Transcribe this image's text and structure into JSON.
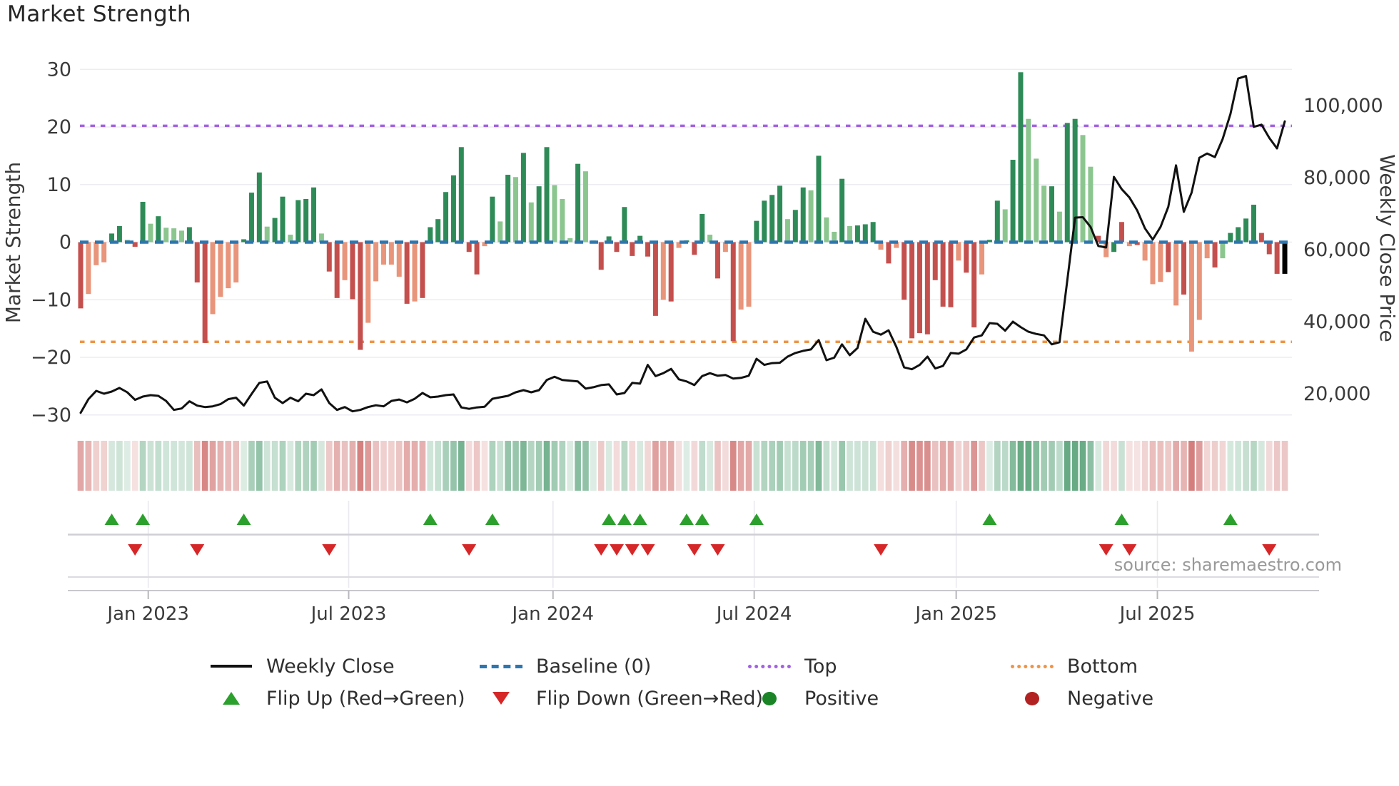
{
  "title": "Market Strength",
  "source": "source: sharemaestro.com",
  "axes": {
    "y_left_label": "Market Strength",
    "y_right_label": "Weekly Close Price",
    "y_left_ticks": [
      30,
      20,
      10,
      0,
      -10,
      -20,
      -30
    ],
    "y_right_ticks": [
      100000,
      80000,
      60000,
      40000,
      20000
    ],
    "x_ticks": [
      {
        "label": "Jan 2023",
        "week": 8.7
      },
      {
        "label": "Jul 2023",
        "week": 34.5
      },
      {
        "label": "Jan 2024",
        "week": 60.8
      },
      {
        "label": "Jul 2024",
        "week": 86.7
      },
      {
        "label": "Jan 2025",
        "week": 112.7
      },
      {
        "label": "Jul 2025",
        "week": 138.6
      }
    ]
  },
  "colors": {
    "dark_green": "#2e8b57",
    "light_green": "#8cc68f",
    "dark_red": "#c4504e",
    "light_red": "#e8957b",
    "price_line": "#111111",
    "baseline": "#2e76b0",
    "top_line": "#a261e3",
    "bottom_line": "#ef9446",
    "flip_up": "#2ca02c",
    "flip_down": "#d62728",
    "positive_dot": "#1a8426",
    "negative_dot": "#b22222",
    "grid": "#ececf2",
    "axis_text": "#3a3a3a",
    "source_text": "#999999"
  },
  "chart_data": {
    "type": "bar+line",
    "weeks": 156,
    "title": "Market Strength",
    "ylabel_left": "Market Strength",
    "ylabel_right": "Weekly Close Price",
    "y_left_range": [
      -32,
      32
    ],
    "baseline_value": 0,
    "top_line_value": 20.2,
    "bottom_line_value": -17.3,
    "legend_position": "bottom",
    "grid": true,
    "heatmap_from_bars": true,
    "bar_values": [
      -11.5,
      -9,
      -4,
      -3.5,
      1.5,
      2.8,
      0.4,
      -0.8,
      7,
      3.2,
      4.5,
      2.5,
      2.4,
      2,
      2.6,
      -7,
      -17.5,
      -12.5,
      -9.5,
      -8,
      -7,
      0.5,
      8.6,
      12.1,
      2.7,
      4.2,
      7.9,
      1.3,
      7.3,
      7.5,
      9.5,
      1.5,
      -5.1,
      -9.7,
      -6.6,
      -9.9,
      -18.7,
      -14,
      -6.8,
      -3.9,
      -3.9,
      -6,
      -10.7,
      -10.3,
      -9.7,
      2.6,
      4,
      8.7,
      11.6,
      16.5,
      -1.7,
      -5.6,
      -0.7,
      7.9,
      3.6,
      11.7,
      11.3,
      15.5,
      6.9,
      9.7,
      16.5,
      9.9,
      7.5,
      0.7,
      13.6,
      12.3,
      0.3,
      -4.8,
      1,
      -1.7,
      6.1,
      -2.4,
      1.1,
      -2.5,
      -12.8,
      -10,
      -10.3,
      -1,
      0.3,
      -2.2,
      4.9,
      1.3,
      -6.3,
      -1.7,
      -17.2,
      -11.7,
      -11.2,
      3.7,
      7.2,
      8.2,
      9.8,
      4,
      5.6,
      9.5,
      9,
      15,
      4.3,
      1.8,
      11,
      2.8,
      2.9,
      3.1,
      3.5,
      -1.3,
      -3.7,
      -1,
      -10,
      -16.7,
      -15.8,
      -16,
      -6.6,
      -11.2,
      -11.3,
      -3.2,
      -5.3,
      -14.8,
      -5.6,
      0.4,
      7.2,
      5.7,
      14.3,
      29.5,
      21.4,
      14.5,
      9.8,
      9.7,
      5.3,
      20.7,
      21.4,
      18.6,
      13.1,
      1.1,
      -2.6,
      -1.7,
      3.5,
      -0.7,
      -0.5,
      -3.2,
      -7.3,
      -6.9,
      -5.2,
      -11,
      -9.1,
      -19,
      -13.5,
      -2.8,
      -4.4,
      -2.8,
      1.6,
      2.6,
      4.1,
      6.5,
      1.6,
      -2.1,
      -5.5,
      -5.5
    ],
    "bar_shades": "rsssgglrglglllgrrssssggglgglggglrrsrrsssssrsrgggggrrsglglglgglllgllrgrgrgrrsrsgrglrsrssgggglgglgllglgggsrsrrrrrrrsrrsgglgglllglggllrsgrsrsssrsrsssrlggggrrr",
    "weekly_close_price_k": [
      14.7,
      18.5,
      20.8,
      20.0,
      20.6,
      21.6,
      20.4,
      18.3,
      19.2,
      19.6,
      19.4,
      18.0,
      15.5,
      15.9,
      17.9,
      16.7,
      16.3,
      16.5,
      17.1,
      18.5,
      18.9,
      16.7,
      19.9,
      23.0,
      23.4,
      18.9,
      17.4,
      18.9,
      17.9,
      20.0,
      19.6,
      21.2,
      17.4,
      15.5,
      16.3,
      15.1,
      15.5,
      16.3,
      16.8,
      16.5,
      18.0,
      18.4,
      17.6,
      18.6,
      20.2,
      19.0,
      19.2,
      19.6,
      19.8,
      16.2,
      15.8,
      16.2,
      16.4,
      18.6,
      19.0,
      19.4,
      20.4,
      21.0,
      20.4,
      21.0,
      23.8,
      24.7,
      23.8,
      23.6,
      23.4,
      21.4,
      21.8,
      22.4,
      22.6,
      19.8,
      20.2,
      23.0,
      22.8,
      28.0,
      24.9,
      25.7,
      26.9,
      24.0,
      23.4,
      22.4,
      24.9,
      25.7,
      25.0,
      25.2,
      24.2,
      24.4,
      25.0,
      29.7,
      28.0,
      28.5,
      28.6,
      30.3,
      31.3,
      31.9,
      32.3,
      34.9,
      29.3,
      30.0,
      33.7,
      30.7,
      32.7,
      40.8,
      37.2,
      36.4,
      37.6,
      33.0,
      27.3,
      26.8,
      28.0,
      30.3,
      27.0,
      27.7,
      31.3,
      31.1,
      32.3,
      35.6,
      36.2,
      39.6,
      39.4,
      37.5,
      40.0,
      38.5,
      37.2,
      36.6,
      36.2,
      33.7,
      34.3,
      51.5,
      68.9,
      69.0,
      66.3,
      61.0,
      60.6,
      80.2,
      76.8,
      74.5,
      70.9,
      65.9,
      62.8,
      66.3,
      71.9,
      83.4,
      70.5,
      75.8,
      85.5,
      86.7,
      85.7,
      90.7,
      97.6,
      107.5,
      108.2,
      94.1,
      94.7,
      91.0,
      88.1,
      95.6
    ],
    "flip_up_weeks": [
      4,
      8,
      21,
      45,
      53,
      68,
      70,
      72,
      78,
      80,
      87,
      117,
      134,
      148
    ],
    "flip_down_weeks": [
      7,
      15,
      32,
      50,
      67,
      69,
      71,
      73,
      79,
      82,
      103,
      132,
      135,
      153
    ]
  },
  "legend": {
    "rows": [
      [
        {
          "swatch": "line",
          "icon": "black-line-icon",
          "label": "Weekly Close"
        },
        {
          "swatch": "dash-blue",
          "icon": "blue-dash-icon",
          "label": "Baseline (0)"
        },
        {
          "swatch": "dot-purple",
          "icon": "purple-dot-line-icon",
          "label": "Top"
        },
        {
          "swatch": "dot-orange",
          "icon": "orange-dot-line-icon",
          "label": "Bottom"
        }
      ],
      [
        {
          "swatch": "tri-up",
          "icon": "green-triangle-up-icon",
          "label": "Flip Up (Red→Green)"
        },
        {
          "swatch": "tri-down",
          "icon": "red-triangle-down-icon",
          "label": "Flip Down (Green→Red)"
        },
        {
          "swatch": "circle-green",
          "icon": "green-circle-icon",
          "label": "Positive"
        },
        {
          "swatch": "circle-red",
          "icon": "red-circle-icon",
          "label": "Negative"
        }
      ]
    ]
  }
}
